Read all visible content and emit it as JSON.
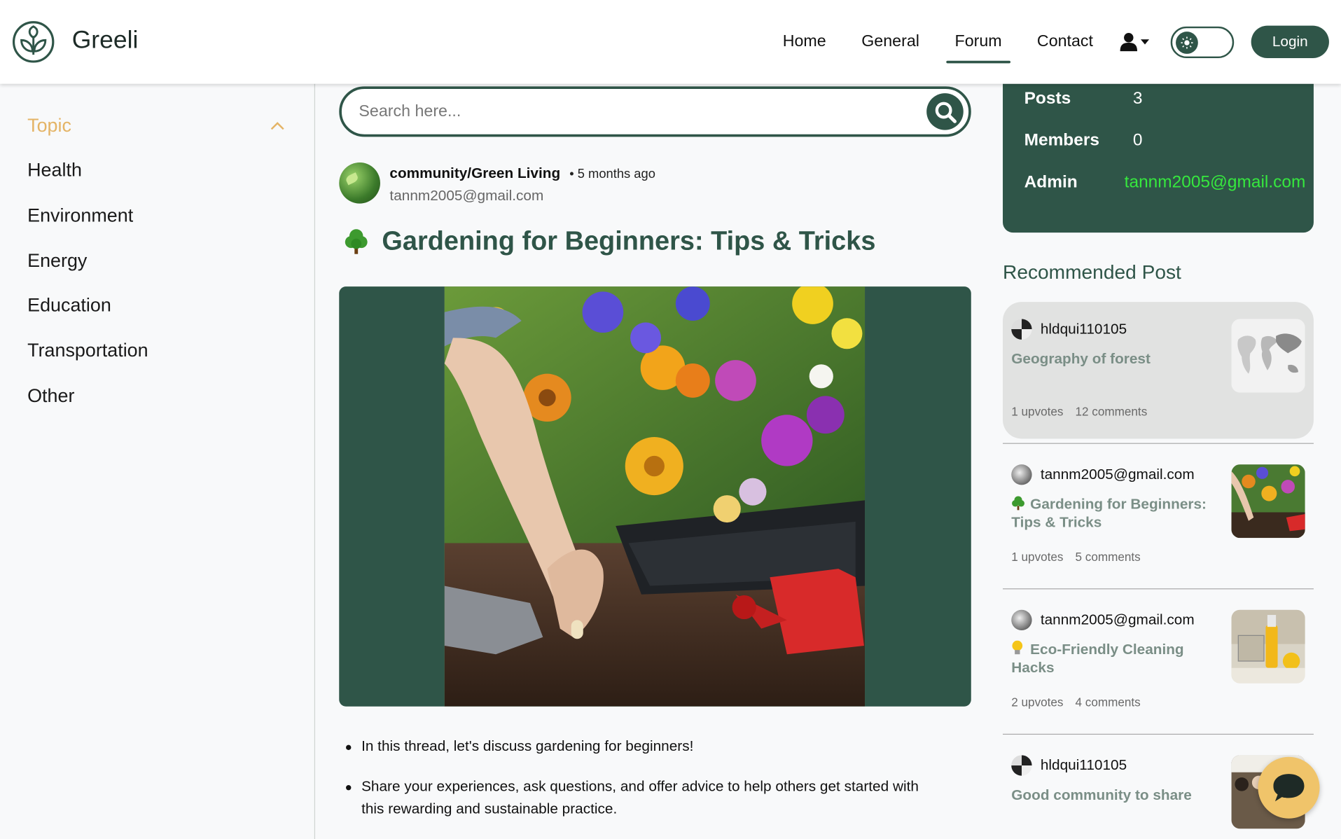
{
  "header": {
    "brand": "Greeli",
    "nav": [
      "Home",
      "General",
      "Forum",
      "Contact"
    ],
    "active_nav": "Forum",
    "login_label": "Login",
    "accent": "#2f5548"
  },
  "sidebar": {
    "topic_label": "Topic",
    "items": [
      "Health",
      "Environment",
      "Energy",
      "Education",
      "Transportation",
      "Other"
    ]
  },
  "search": {
    "placeholder": "Search here..."
  },
  "post": {
    "community": "community/Green Living",
    "time": "• 5 months ago",
    "author_email": "tannm2005@gmail.com",
    "title": "Gardening for Beginners: Tips & Tricks",
    "title_icon": "tree-icon",
    "bullets": [
      "In this thread, let's discuss gardening for beginners!",
      "Share your experiences, ask questions, and offer advice to help others get started with this rewarding and sustainable practice."
    ]
  },
  "community_info": {
    "posts_label": "Posts",
    "posts_value": "3",
    "members_label": "Members",
    "members_value": "0",
    "admin_label": "Admin",
    "admin_value": "tannm2005@gmail.com"
  },
  "recommended": {
    "heading": "Recommended Post",
    "items": [
      {
        "author": "hldqui110105",
        "title": "Geography of forest",
        "upvotes": "1 upvotes",
        "comments": "12 comments"
      },
      {
        "author": "tannm2005@gmail.com",
        "title": "Gardening for Beginners: Tips & Tricks",
        "title_icon": "tree-icon",
        "upvotes": "1 upvotes",
        "comments": "5 comments"
      },
      {
        "author": "tannm2005@gmail.com",
        "title": "Eco-Friendly Cleaning Hacks",
        "title_icon": "lightbulb-icon",
        "upvotes": "2 upvotes",
        "comments": "4 comments"
      },
      {
        "author": "hldqui110105",
        "title": "Good community to share"
      }
    ]
  }
}
